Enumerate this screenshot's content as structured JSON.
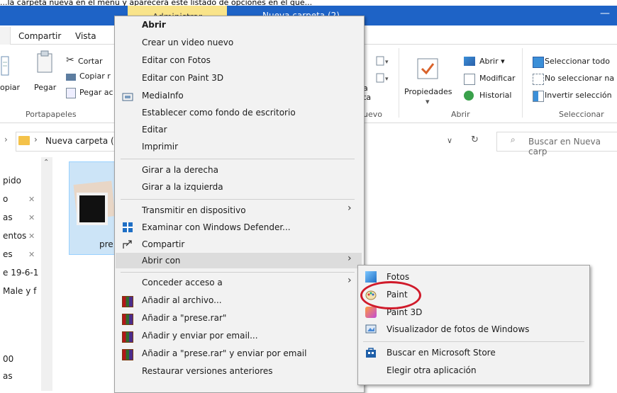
{
  "window": {
    "caption_text": "...la carpeta nueva en el menú y aparecerá este listado de opciones en el que...",
    "admin_tab": "Administrar",
    "title": "Nueva carpeta (2)",
    "minimize": "—"
  },
  "menu_tabs": [
    "Compartir",
    "Vista"
  ],
  "ribbon": {
    "portapapeles": {
      "copy_partial": "opiar",
      "paste": "Pegar",
      "cut": "Cortar",
      "copy_path": "Copiar r",
      "paste_shortcut": "Pegar ac",
      "label": "Portapapeles"
    },
    "nuevo_label_partial": "uevo",
    "nuevo_a": "a",
    "nuevo_ta": "ta",
    "abrir": {
      "properties": "Propiedades",
      "open": "Abrir ▾",
      "edit": "Modificar",
      "history": "Historial",
      "label": "Abrir"
    },
    "seleccionar": {
      "select_all": "Seleccionar todo",
      "select_none": "No seleccionar na",
      "invert": "Invertir selección",
      "label": "Seleccionar"
    }
  },
  "address": {
    "path": "Nueva carpeta (2",
    "search_placeholder": "Buscar en Nueva carp"
  },
  "nav_items": [
    "pido",
    "o",
    "as",
    "entos",
    "es",
    "e 19-6-1",
    "Male y f",
    "00",
    "as"
  ],
  "file": {
    "label": "pre"
  },
  "context_menu": {
    "items": [
      "Abrir",
      "Crear un video nuevo",
      "Editar con Fotos",
      "Editar con Paint 3D",
      "MediaInfo",
      "Establecer como fondo de escritorio",
      "Editar",
      "Imprimir",
      "Girar a la derecha",
      "Girar a la izquierda",
      "Transmitir en dispositivo",
      "Examinar con Windows Defender...",
      "Compartir",
      "Abrir con",
      "Conceder acceso a",
      "Añadir al archivo...",
      "Añadir a \"prese.rar\"",
      "Añadir y enviar por email...",
      "Añadir a \"prese.rar\" y enviar por email",
      "Restaurar versiones anteriores"
    ]
  },
  "submenu": {
    "items": [
      "Fotos",
      "Paint",
      "Paint 3D",
      "Visualizador de fotos de Windows",
      "Buscar en Microsoft Store",
      "Elegir otra aplicación"
    ]
  },
  "colors": {
    "titlebar": "#1e63c6",
    "admin_tab": "#f9e48a",
    "highlight_oval": "#d01a2a",
    "menu_bg": "#f2f2f2"
  }
}
